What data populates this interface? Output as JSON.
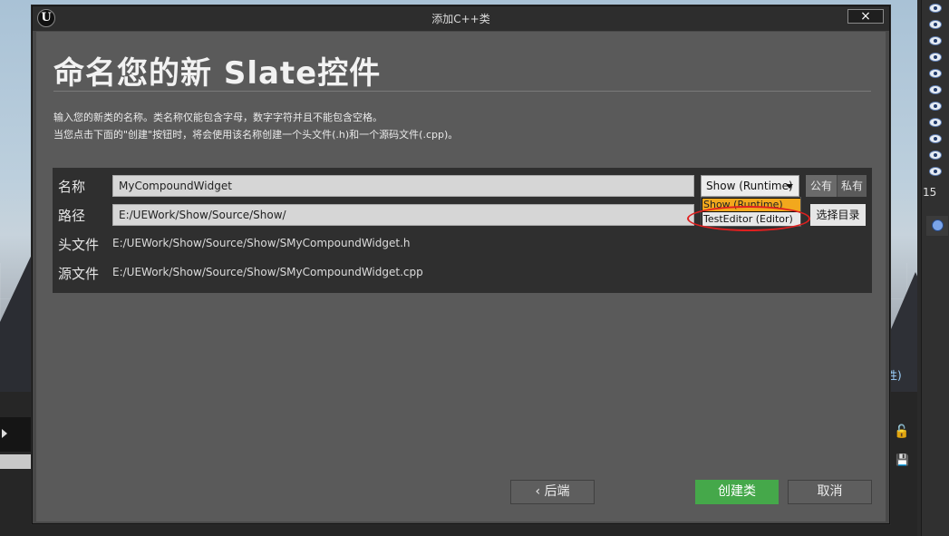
{
  "dialog": {
    "title": "添加C++类",
    "close_icon": "×",
    "heading": "命名您的新 Slate控件",
    "description_line1": "输入您的新类的名称。类名称仅能包含字母，数字字符并且不能包含空格。",
    "description_line2": "当您点击下面的\"创建\"按钮时，将会使用该名称创建一个头文件(.h)和一个源码文件(.cpp)。"
  },
  "form": {
    "name_label": "名称",
    "name_value": "MyCompoundWidget",
    "path_label": "路径",
    "path_value": "E:/UEWork/Show/Source/Show/",
    "header_label": "头文件",
    "header_value": "E:/UEWork/Show/Source/Show/SMyCompoundWidget.h",
    "source_label": "源文件",
    "source_value": "E:/UEWork/Show/Source/Show/SMyCompoundWidget.cpp",
    "module_selected": "Show (Runtime)",
    "module_options": [
      "Show (Runtime)",
      "TestEditor (Editor)"
    ],
    "access_public": "公有",
    "access_private": "私有",
    "choose_folder": "选择目录"
  },
  "footer": {
    "back": "后端",
    "create": "创建类",
    "cancel": "取消"
  },
  "background": {
    "right_panel_number": "15",
    "details_text": "性)"
  },
  "colors": {
    "create_button": "#45a84a",
    "dropdown_highlight": "#f2a81d",
    "annotation": "#e02020"
  }
}
